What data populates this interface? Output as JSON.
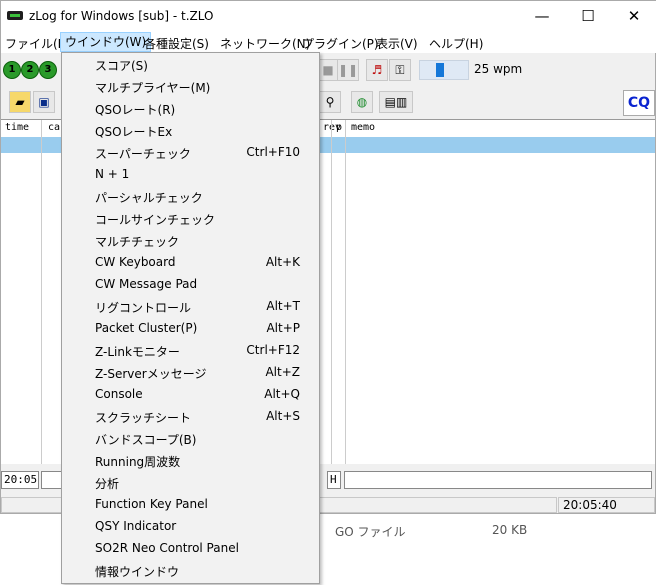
{
  "window": {
    "title": "zLog for Windows  [sub] - t.ZLO",
    "controls": {
      "minimize": "—",
      "maximize": "☐",
      "close": "✕"
    }
  },
  "menubar": [
    "ファイル(F)",
    "ウインドウ(W)",
    "各種設定(S)",
    "ネットワーク(N)",
    "プラグイン(P)",
    "表示(V)",
    "ヘルプ(H)"
  ],
  "toolbar1": {
    "circles": [
      "1",
      "2",
      "3"
    ],
    "wpm": "25 wpm",
    "wpm_level_fraction": 0.4
  },
  "toolbar2": {
    "cq_label": "CQ"
  },
  "grid": {
    "headers": [
      "time",
      "ca",
      "rev",
      "p",
      "memo"
    ]
  },
  "input_row": {
    "time": "20:05",
    "mode_letter": "H"
  },
  "status": {
    "clock": "20:05:40"
  },
  "background_text": {
    "file_type": "GO ファイル",
    "file_size": "20 KB"
  },
  "dropdown": {
    "items": [
      {
        "label": "スコア(S)",
        "shortcut": ""
      },
      {
        "label": "マルチプライヤー(M)",
        "shortcut": ""
      },
      {
        "label": "QSOレート(R)",
        "shortcut": ""
      },
      {
        "label": "QSOレートEx",
        "shortcut": ""
      },
      {
        "label": "スーパーチェック",
        "shortcut": "Ctrl+F10"
      },
      {
        "label": "N + 1",
        "shortcut": ""
      },
      {
        "label": "パーシャルチェック",
        "shortcut": ""
      },
      {
        "label": "コールサインチェック",
        "shortcut": ""
      },
      {
        "label": "マルチチェック",
        "shortcut": ""
      },
      {
        "label": "CW Keyboard",
        "shortcut": "Alt+K"
      },
      {
        "label": "CW Message Pad",
        "shortcut": ""
      },
      {
        "label": "リグコントロール",
        "shortcut": "Alt+T"
      },
      {
        "label": "Packet Cluster(P)",
        "shortcut": "Alt+P"
      },
      {
        "label": "Z-Linkモニター",
        "shortcut": "Ctrl+F12"
      },
      {
        "label": "Z-Serverメッセージ",
        "shortcut": "Alt+Z"
      },
      {
        "label": "Console",
        "shortcut": "Alt+Q"
      },
      {
        "label": "スクラッチシート",
        "shortcut": "Alt+S"
      },
      {
        "label": "バンドスコープ(B)",
        "shortcut": ""
      },
      {
        "label": "Running周波数",
        "shortcut": ""
      },
      {
        "label": "分析",
        "shortcut": ""
      },
      {
        "label": "Function Key Panel",
        "shortcut": ""
      },
      {
        "label": "QSY Indicator",
        "shortcut": ""
      },
      {
        "label": "SO2R Neo Control Panel",
        "shortcut": ""
      },
      {
        "label": "情報ウインドウ",
        "shortcut": ""
      }
    ]
  }
}
